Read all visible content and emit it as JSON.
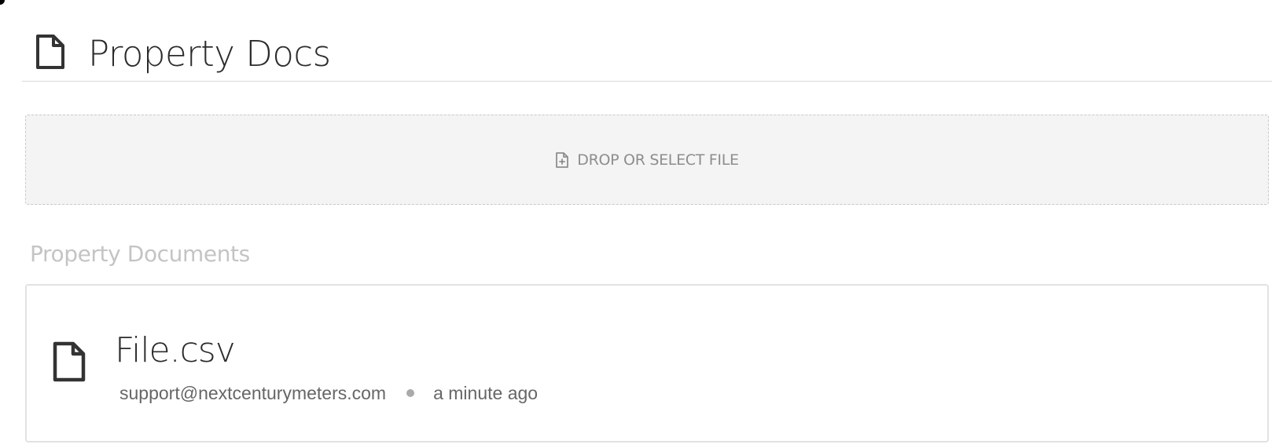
{
  "header": {
    "icon": "file-icon",
    "title": "Property Docs"
  },
  "dropzone": {
    "icon": "file-plus-icon",
    "label": "DROP OR SELECT FILE"
  },
  "documents_section": {
    "title": "Property Documents",
    "items": [
      {
        "icon": "file-icon",
        "name": "File.csv",
        "uploader": "support@nextcenturymeters.com",
        "uploaded": "a minute ago"
      }
    ]
  },
  "colors": {
    "icon": "#333333",
    "dropzone_bg": "#f4f4f4",
    "muted_text": "#8d8d8d",
    "section_title": "#c4c4c4",
    "border": "#e2e2e2"
  }
}
